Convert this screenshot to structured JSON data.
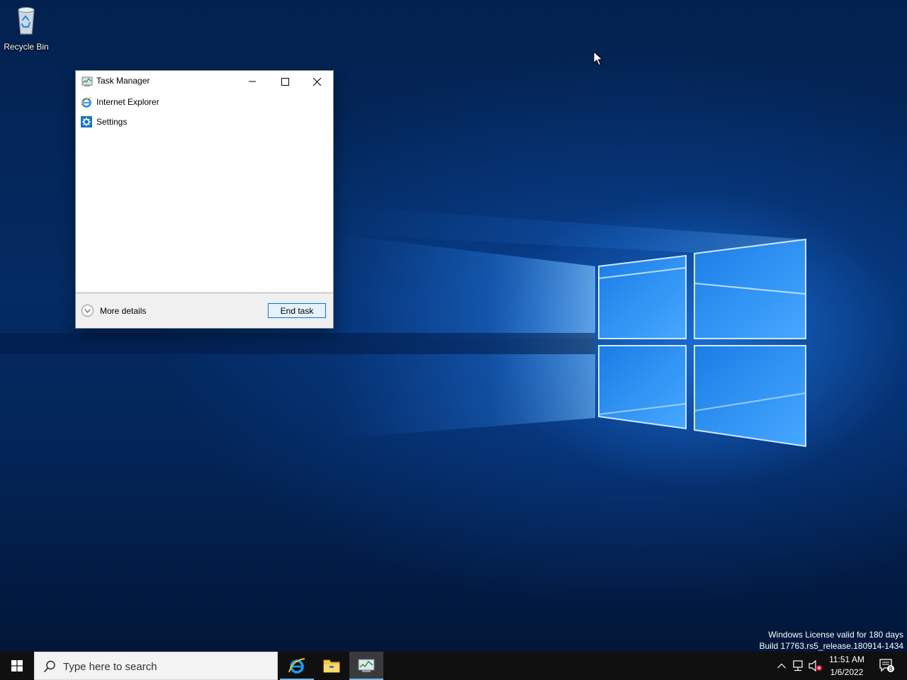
{
  "desktop": {
    "icons": [
      {
        "label": "Recycle Bin",
        "icon": "recycle-bin-icon"
      }
    ],
    "watermark": {
      "line1": "Windows License valid for 180 days",
      "line2": "Build 17763.rs5_release.180914-1434"
    }
  },
  "task_manager": {
    "title": "Task Manager",
    "apps": [
      {
        "name": "Internet Explorer",
        "icon": "internet-explorer-icon"
      },
      {
        "name": "Settings",
        "icon": "settings-gear-icon"
      }
    ],
    "more_details_label": "More details",
    "end_task_label": "End task"
  },
  "taskbar": {
    "search_placeholder": "Type here to search",
    "pinned": [
      "internet-explorer-icon",
      "file-explorer-icon",
      "task-manager-icon"
    ],
    "clock": {
      "time": "11:51 AM",
      "date": "1/6/2022"
    },
    "notification_count": "8"
  },
  "colors": {
    "accent": "#0078d7",
    "taskbar": "#101010",
    "wallpaper_dark": "#03214f",
    "wallpaper_glow": "#2a8cff"
  }
}
